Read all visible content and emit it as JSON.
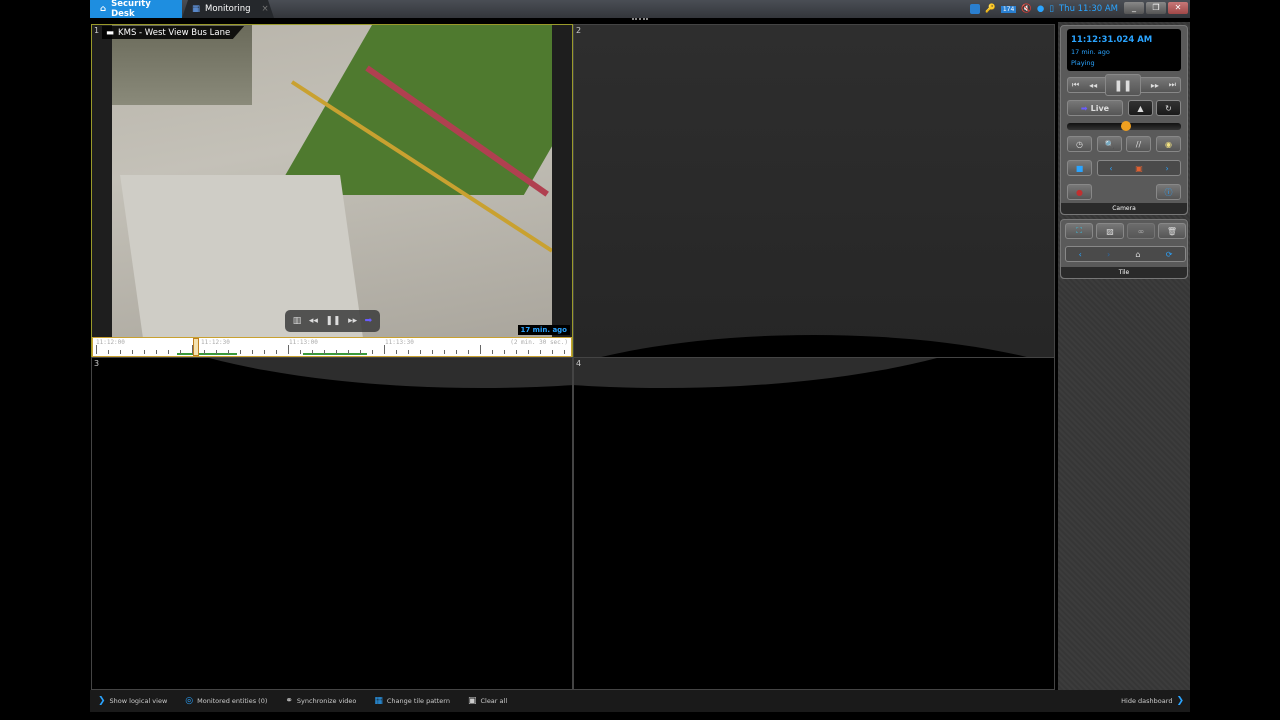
{
  "tabs": [
    {
      "label": "Security Desk",
      "icon": "home-icon"
    },
    {
      "label": "Monitoring",
      "icon": "monitoring-icon"
    }
  ],
  "tray": {
    "badge": "174",
    "clock": "Thu 11:30 AM"
  },
  "tiles": [
    {
      "number": "1",
      "camera": "KMS - West View Bus Lane",
      "age": "17 min. ago",
      "timeline": {
        "labels": [
          "11:12:00",
          "11:12:30",
          "11:13:00",
          "11:13:30"
        ],
        "span": "(2 min. 30 sec.)",
        "cursor_fraction": 0.21
      }
    },
    {
      "number": "2"
    },
    {
      "number": "3"
    },
    {
      "number": "4"
    }
  ],
  "camera_panel": {
    "time": "11:12:31.024 AM",
    "age": "17 min. ago",
    "state": "Playing",
    "live_label": "Live",
    "speed_fraction": 0.52,
    "caption": "Camera"
  },
  "tile_panel": {
    "caption": "Tile"
  },
  "bottom": {
    "items": [
      "Show logical view",
      "Monitored entities (0)",
      "Synchronize video",
      "Change tile pattern",
      "Clear all"
    ],
    "hide": "Hide dashboard"
  },
  "colors": {
    "accent": "#1e8ee0",
    "lcd_text": "#2aa4ff",
    "knob": "#f0a020"
  }
}
